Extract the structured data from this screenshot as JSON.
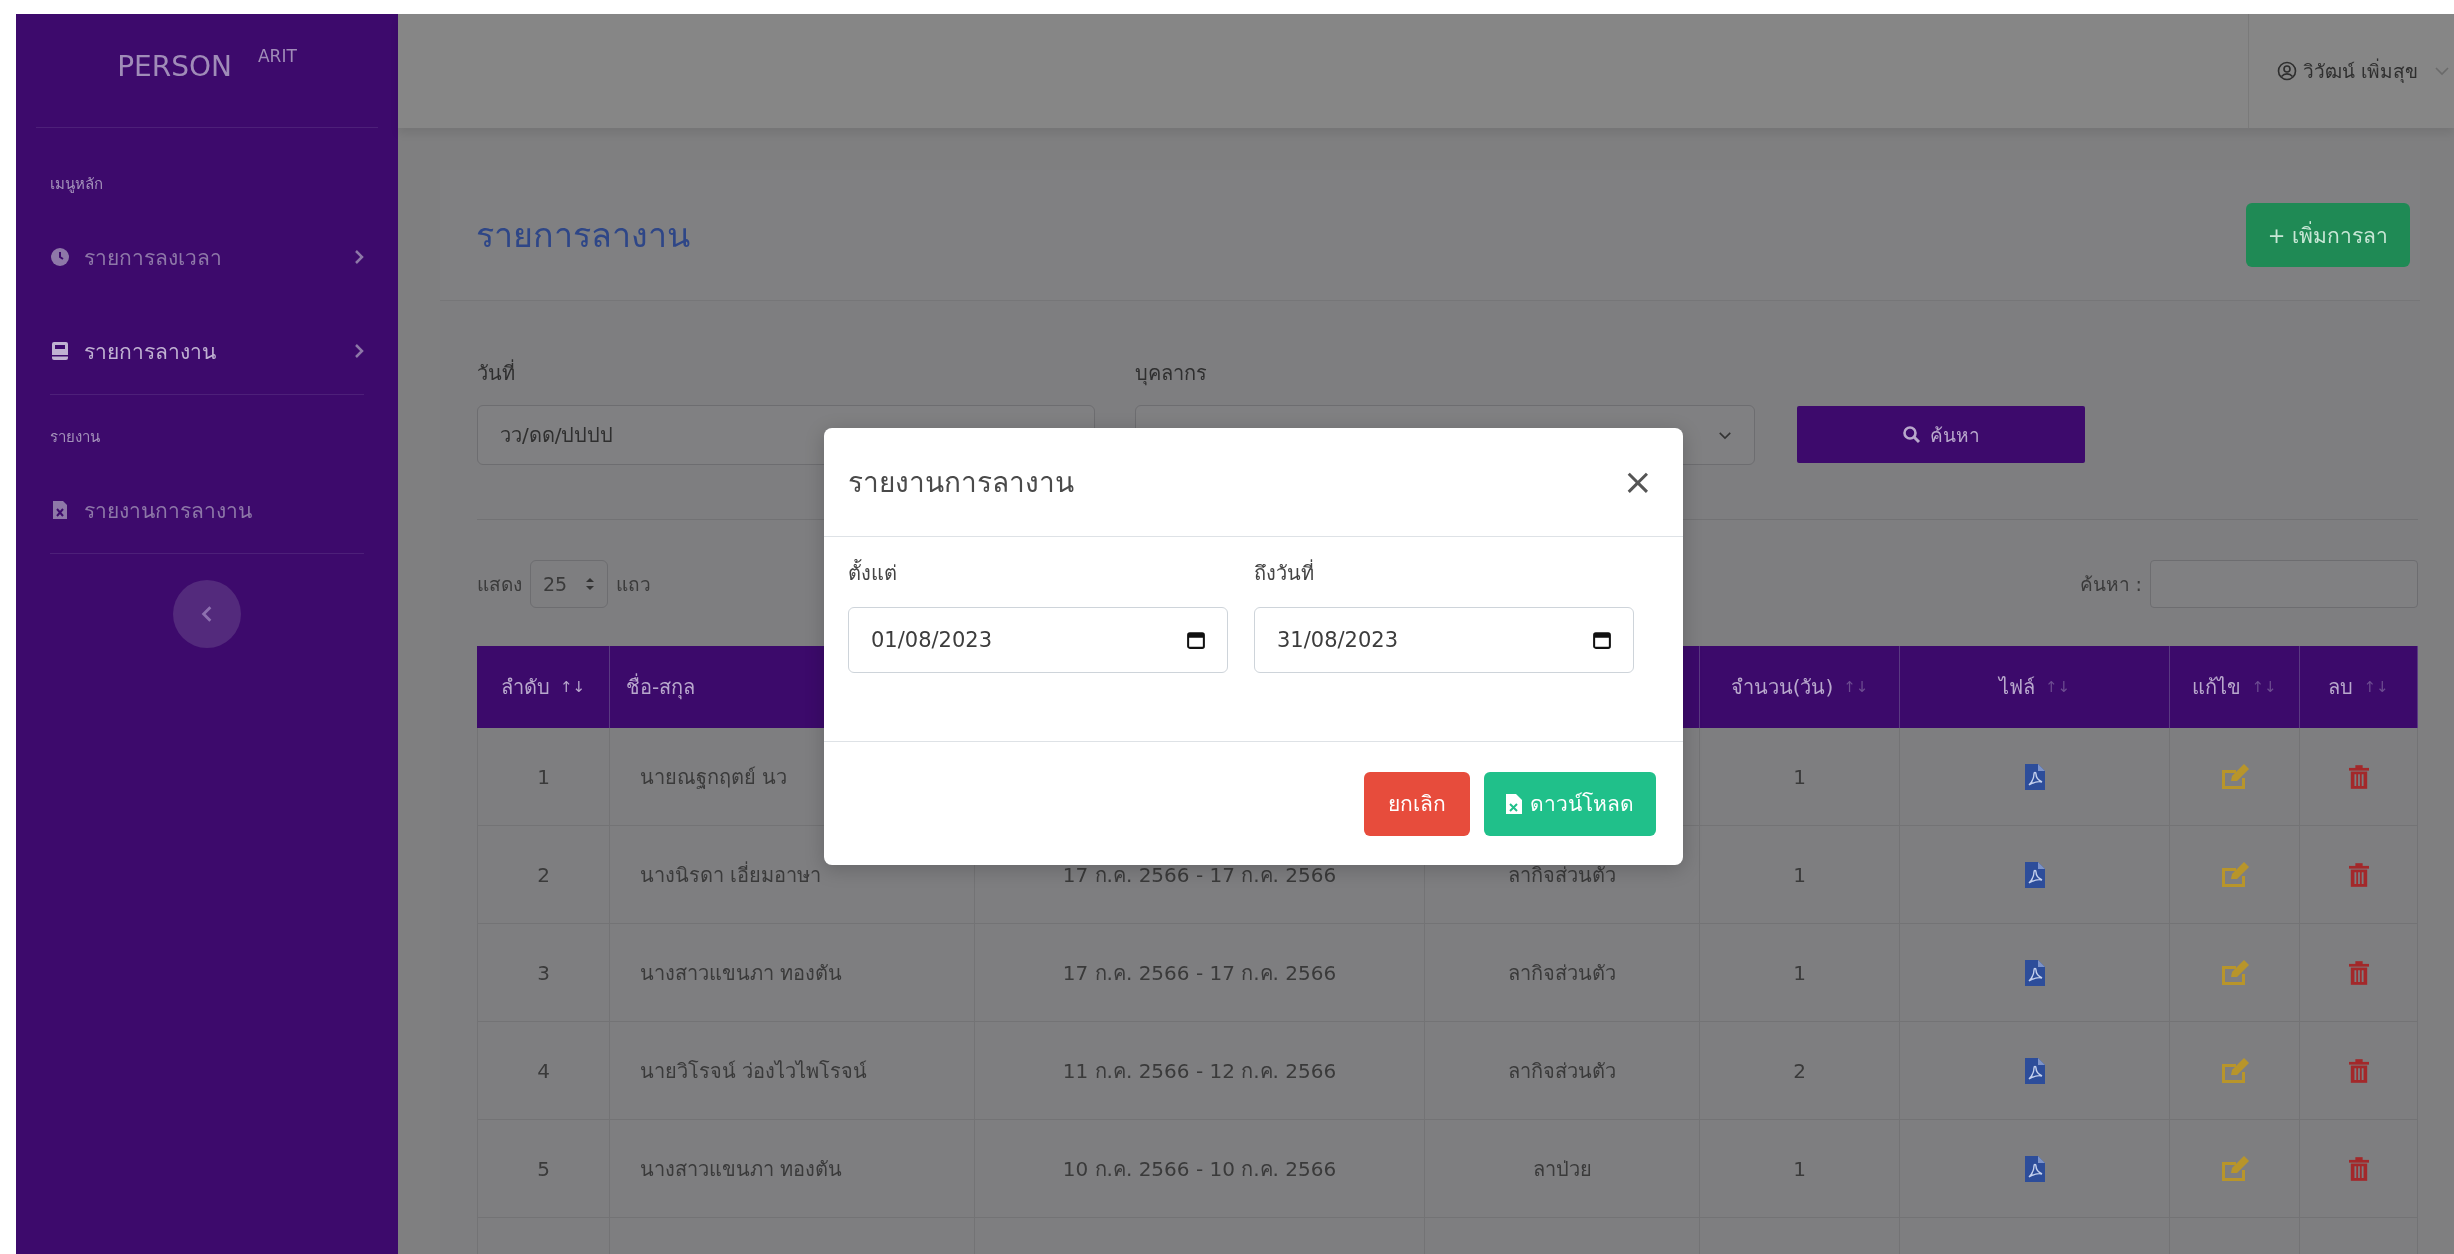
{
  "sidebar": {
    "brand": "PERSON",
    "brand_sup": "ARIT",
    "sections": [
      {
        "label": "เมนูหลัก",
        "items": [
          {
            "label": "รายการลงเวลา",
            "selected": false,
            "expandable": true
          },
          {
            "label": "รายการลางาน",
            "selected": true,
            "expandable": true
          }
        ]
      },
      {
        "label": "รายงาน",
        "items": [
          {
            "label": "รายงานการลางาน",
            "selected": false,
            "expandable": false
          }
        ]
      }
    ]
  },
  "topbar": {
    "user": "วิวัฒน์ เพิ่มสุข"
  },
  "page": {
    "title": "รายการลางาน",
    "add_button": "+ เพิ่มการลา"
  },
  "filters": {
    "date_label": "วันที่",
    "date_placeholder": "วว/ดด/ปปปป",
    "person_label": "บุคลากร",
    "search_button": "ค้นหา"
  },
  "table_controls": {
    "show_label": "แสดง",
    "page_size": "25",
    "rows_label": "แถว",
    "search_label": "ค้นหา :"
  },
  "table": {
    "columns": [
      {
        "label": "ลำดับ",
        "sort_mark": "↑↓",
        "sorted": true
      },
      {
        "label": "ชื่อ-สกุล"
      },
      {},
      {},
      {
        "label": "จำนวน(วัน)",
        "sort_mark": "↑↓",
        "sorted": false
      },
      {
        "label": "ไฟล์",
        "sort_mark": "↑↓",
        "sorted": false
      },
      {
        "label": "แก้ไข",
        "sort_mark": "↑↓",
        "sorted": false
      },
      {
        "label": "ลบ",
        "sort_mark": "↑↓",
        "sorted": false
      }
    ],
    "rows": [
      {
        "no": "1",
        "name": "นายณฐกฤตย์ นว",
        "days": "1"
      },
      {
        "no": "2",
        "name": "นางนิรดา เอี่ยมอาษา",
        "dates": "17 ก.ค. 2566 - 17 ก.ค. 2566",
        "type": "ลากิจส่วนตัว",
        "days": "1"
      },
      {
        "no": "3",
        "name": "นางสาวแขนภา ทองตัน",
        "dates": "17 ก.ค. 2566 - 17 ก.ค. 2566",
        "type": "ลากิจส่วนตัว",
        "days": "1"
      },
      {
        "no": "4",
        "name": "นายวิโรจน์ ว่องไวไพโรจน์",
        "dates": "11 ก.ค. 2566 - 12 ก.ค. 2566",
        "type": "ลากิจส่วนตัว",
        "days": "2"
      },
      {
        "no": "5",
        "name": "นางสาวแขนภา ทองตัน",
        "dates": "10 ก.ค. 2566 - 10 ก.ค. 2566",
        "type": "ลาป่วย",
        "days": "1"
      }
    ]
  },
  "modal": {
    "title": "รายงานการลางาน",
    "close": "×",
    "from_label": "ตั้งแต่",
    "from_value": "01/08/2023",
    "to_label": "ถึงวันที่",
    "to_value": "31/08/2023",
    "cancel_button": "ยกเลิก",
    "download_button": "ดาวน์โหลด"
  }
}
